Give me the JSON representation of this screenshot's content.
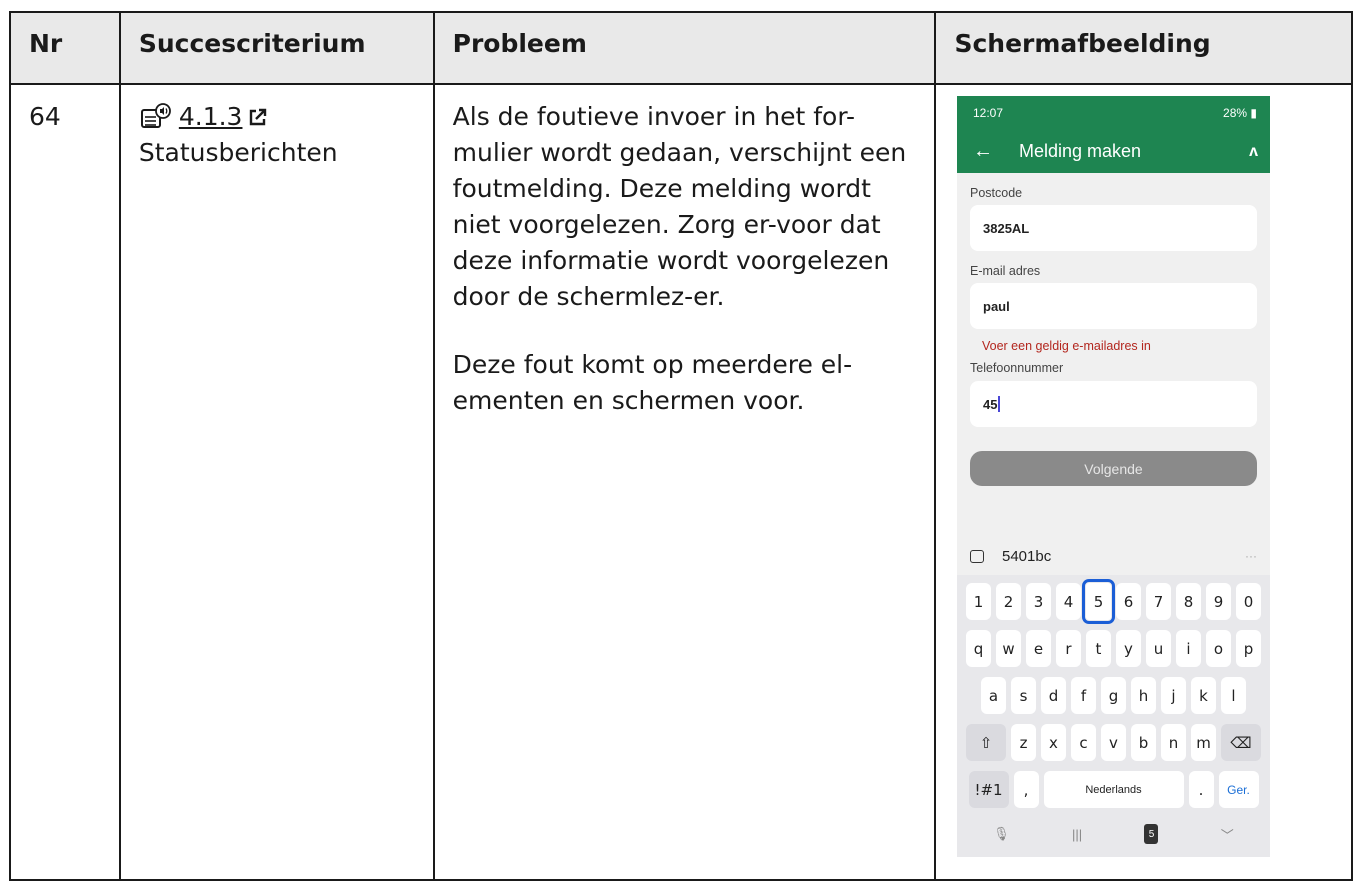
{
  "table": {
    "headers": [
      "Nr",
      "Succescriterium",
      "Probleem",
      "Schermafbeelding"
    ],
    "row": {
      "nr": "64",
      "criterion_code": "4.1.3",
      "criterion_name": "Statusberichten",
      "problem_paragraphs": [
        "Als de foutieve invoer in het for-mulier wordt gedaan, verschijnt een foutmelding. Deze melding wordt niet voorgelezen. Zorg er-voor dat deze informatie wordt voorgelezen door de schermlez-er.",
        "Deze fout komt op meerdere el-ementen en schermen voor."
      ]
    }
  },
  "phone": {
    "status_time": "12:07",
    "status_right": "28%",
    "title": "Melding maken",
    "fields": [
      {
        "label": "Postcode",
        "value": "3825AL"
      },
      {
        "label": "E-mail adres",
        "value": "paul",
        "error": "Voer een geldig e-mailadres in"
      },
      {
        "label": "Telefoonnummer",
        "value": "45"
      }
    ],
    "next_button": "Volgende",
    "suggestion": "5401bc",
    "keyboard": {
      "row1": [
        "1",
        "2",
        "3",
        "4",
        "5",
        "6",
        "7",
        "8",
        "9",
        "0"
      ],
      "row2": [
        "q",
        "w",
        "e",
        "r",
        "t",
        "y",
        "u",
        "i",
        "o",
        "p"
      ],
      "row3": [
        "a",
        "s",
        "d",
        "f",
        "g",
        "h",
        "j",
        "k",
        "l"
      ],
      "row4": [
        "z",
        "x",
        "c",
        "v",
        "b",
        "n",
        "m"
      ],
      "symbols_key": "!#1",
      "comma_key": ",",
      "space_label": "Nederlands",
      "period_key": ".",
      "go_key": "Ger.",
      "nav_badge": "5"
    },
    "accent_color": "#1e8551"
  }
}
